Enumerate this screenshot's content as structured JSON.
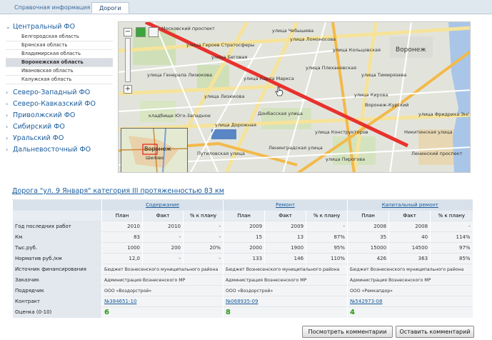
{
  "tabs": [
    {
      "label": "Справочная информация",
      "active": false
    },
    {
      "label": "Дороги",
      "active": true
    }
  ],
  "sidebar": {
    "regions": [
      {
        "label": "Центральный ФО",
        "expanded": true
      },
      {
        "label": "Северо-Западный ФО",
        "expanded": false
      },
      {
        "label": "Северо-Кавказский ФО",
        "expanded": false
      },
      {
        "label": "Приволжский ФО",
        "expanded": false
      },
      {
        "label": "Сибирский ФО",
        "expanded": false
      },
      {
        "label": "Уральский ФО",
        "expanded": false
      },
      {
        "label": "Дальневосточный ФО",
        "expanded": false
      }
    ],
    "subregions": [
      "Белгородская область",
      "Брянская область",
      "Владимирская область",
      "Воронежская область",
      "Ивановская область",
      "Калужская область"
    ],
    "selected_subregion": "Воронежская область"
  },
  "map": {
    "city_label": "Воронеж",
    "overview_label": "Воронеж",
    "overview_sublabel": "Шилово",
    "street_labels": [
      "улица Беговая",
      "улица Ломоносова",
      "улица Карла Маркса",
      "улица Плехановская",
      "улица Кольцовская",
      "Донбасская улица",
      "улица Дорожная",
      "Ленинградская улица",
      "Путиловская улица",
      "Никитинская улица",
      "улица Кирова",
      "Воронеж-Курский",
      "кладбище Юго-Западное",
      "Московский проспект",
      "улица Героев Стратосферы",
      "улица Лизюкова",
      "улица Конструкторов",
      "улица Пирогова",
      "улица Генерала Лизюкова",
      "Ленинский проспект",
      "улица Чебышева",
      "улица Тимирязева",
      "улица Фридриха Энгельса"
    ],
    "road_color": "#e8322e"
  },
  "road": {
    "title": "Дорога \"ул. 9 Января\" категория III протяженностью 83 км"
  },
  "table": {
    "groups": [
      "Содержание",
      "Ремонт",
      "Капитальный ремонт"
    ],
    "subheaders": [
      "План",
      "Факт",
      "% к плану"
    ],
    "numeric_rows": [
      {
        "label": "Год последних работ",
        "values": [
          "2010",
          "2010",
          "-",
          "2009",
          "2009",
          "-",
          "2008",
          "2008",
          "-"
        ]
      },
      {
        "label": "Км",
        "values": [
          "83",
          "-",
          "-",
          "15",
          "13",
          "87%",
          "35",
          "40",
          "114%"
        ]
      },
      {
        "label": "Тыс.руб.",
        "values": [
          "1000",
          "200",
          "20%",
          "2000",
          "1900",
          "95%",
          "15000",
          "14500",
          "97%"
        ]
      },
      {
        "label": "Норматив руб./км",
        "values": [
          "12,0",
          "-",
          "-",
          "133",
          "146",
          "110%",
          "426",
          "363",
          "85%"
        ]
      }
    ],
    "text_rows": [
      {
        "label": "Источник финансирования",
        "values": [
          "Бюджет Вознесенского муниципального района",
          "Бюджет Вознесенского муниципального района",
          "Бюджет Вознесенского муниципального района"
        ]
      },
      {
        "label": "Заказчик",
        "values": [
          "Администрация Вознесенского МР",
          "Администрация Вознесенского МР",
          "Администрация Вознесенского МР"
        ]
      },
      {
        "label": "Подрядчик",
        "values": [
          "ООО «Воздорстрой»",
          "ООО «Воздорстрой»",
          "ООО «Ремкапдор»"
        ]
      }
    ],
    "contract_row": {
      "label": "Контракт",
      "values": [
        "№384651-10",
        "№068935-09",
        "№542973-08"
      ]
    },
    "score_row": {
      "label": "Оценка (0-10)",
      "values": [
        "6",
        "8",
        "4"
      ]
    },
    "score_color": "#2a9a12"
  },
  "buttons": {
    "view_comments": "Посмотреть комментарии",
    "leave_comment": "Оставить комментарий"
  }
}
